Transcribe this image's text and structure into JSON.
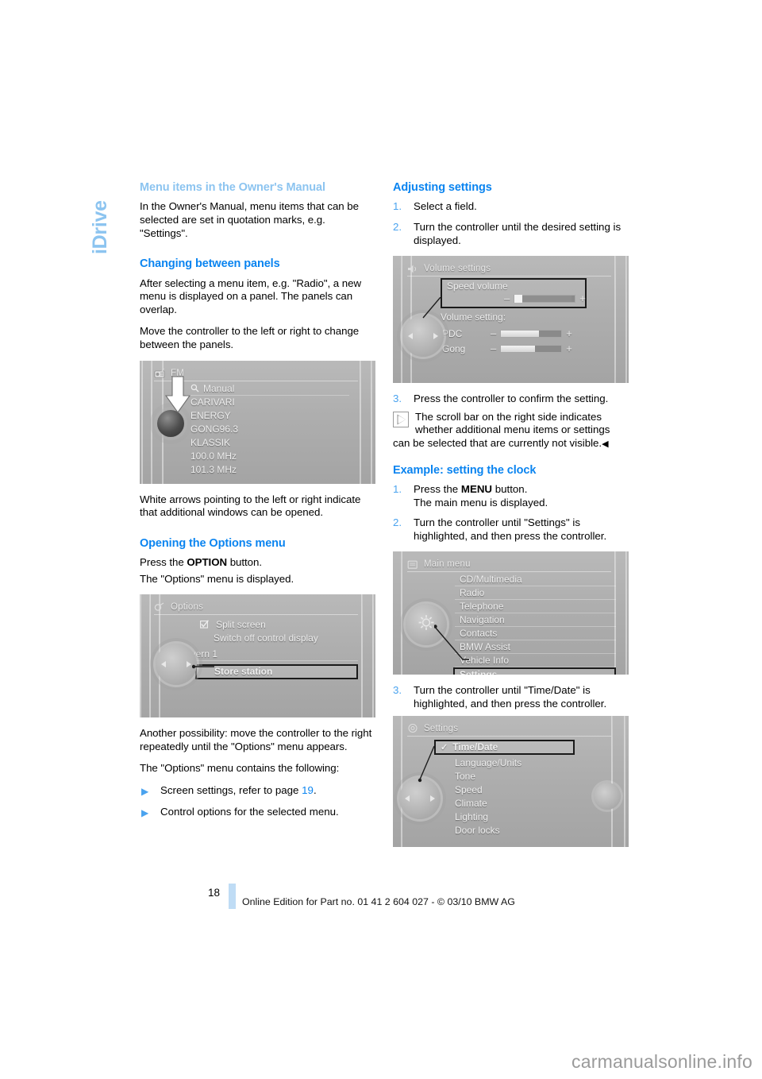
{
  "chapter_tab": "iDrive",
  "left_column": {
    "section1": {
      "heading": "Menu items in the Owner's Manual",
      "paragraphs": [
        "In the Owner's Manual, menu items that can be selected are set in quotation marks, e.g. \"Settings\"."
      ]
    },
    "section2": {
      "heading": "Changing between panels",
      "paragraph1": "After selecting a menu item, e.g. \"Radio\", a new menu is displayed on a panel. The panels can overlap.",
      "paragraph2": "Move the controller to the left or right to change between the panels.",
      "caption": "White arrows pointing to the left or right indicate that additional windows can be opened."
    },
    "section3": {
      "heading": "Opening the Options menu",
      "paragraph1": "Press the OPTION button.",
      "paragraph1_bold": "OPTION",
      "paragraph2": "The \"Options\" menu is displayed.",
      "paragraph3": "Another possibility: move the controller to the right repeatedly until the \"Options\" menu appears.",
      "paragraph4": "The \"Options\" menu contains the following:",
      "bullets": [
        {
          "text": "Screen settings, refer to page ",
          "pageref": "19",
          "suffix": "."
        },
        {
          "text": "Control options for the selected menu.",
          "pageref": "",
          "suffix": ""
        }
      ]
    }
  },
  "right_column": {
    "section1": {
      "heading": "Adjusting settings",
      "steps": [
        {
          "num": "1.",
          "text": "Select a field."
        },
        {
          "num": "2.",
          "text": "Turn the controller until the desired setting is displayed."
        },
        {
          "num": "3.",
          "text": "Press the controller to confirm the setting."
        }
      ],
      "note": "The scroll bar on the right side indicates whether additional menu items or settings can be selected that are currently not visible.",
      "note_endmark": "◀"
    },
    "section2": {
      "heading": "Example: setting the clock",
      "steps": [
        {
          "num": "1.",
          "text": "Press the MENU button.",
          "bold": "MENU",
          "subtext": "The main menu is displayed."
        },
        {
          "num": "2.",
          "text": "Turn the controller until \"Settings\" is highlighted, and then press the controller."
        },
        {
          "num": "3.",
          "text": "Turn the controller until \"Time/Date\" is highlighted, and then press the controller."
        }
      ]
    }
  },
  "figures": {
    "fm_radio": {
      "title": "FM",
      "header_icon": "radio-icon",
      "items": [
        {
          "label": "Manual",
          "icon": "search-icon",
          "ruled": true
        },
        {
          "label": "CARIVARI"
        },
        {
          "label": "ENERGY"
        },
        {
          "label": "GONG96.3"
        },
        {
          "label": "KLASSIK"
        },
        {
          "label": "100.0 MHz"
        },
        {
          "label": "101.3 MHz"
        }
      ],
      "annotation": "white-down-arrow-on-controller"
    },
    "options": {
      "title": "Options",
      "header_icon": "options-icon",
      "items": [
        {
          "label": "Split screen",
          "checkbox": true,
          "checked": true
        },
        {
          "label": "Switch off control display"
        },
        {
          "label": "Bayern 1",
          "ruled": true
        },
        {
          "label": "Store station",
          "selected": true
        }
      ]
    },
    "volume_settings": {
      "title": "Volume settings",
      "header_icon": "speaker-icon",
      "field_label": "Speed volume",
      "field_selected": true,
      "group_label": "Volume setting:",
      "sliders": [
        {
          "label": "Speed volume",
          "minus": "–",
          "plus": "+",
          "value": 12
        },
        {
          "label": "PDC",
          "minus": "–",
          "plus": "+",
          "value": 62
        },
        {
          "label": "Gong",
          "minus": "–",
          "plus": "+",
          "value": 55
        }
      ]
    },
    "main_menu": {
      "title": "Main menu",
      "header_icon": "menu-icon",
      "items": [
        {
          "label": "CD/Multimedia"
        },
        {
          "label": "Radio"
        },
        {
          "label": "Telephone"
        },
        {
          "label": "Navigation"
        },
        {
          "label": "Contacts"
        },
        {
          "label": "BMW Assist"
        },
        {
          "label": "Vehicle Info"
        },
        {
          "label": "Settings",
          "selected": true
        }
      ],
      "knob_icon": "gear-icon"
    },
    "settings": {
      "title": "Settings",
      "header_icon": "gear-icon",
      "items": [
        {
          "label": "Time/Date",
          "check": "✓",
          "selected": true
        },
        {
          "label": "Language/Units"
        },
        {
          "label": "Tone"
        },
        {
          "label": "Speed"
        },
        {
          "label": "Climate"
        },
        {
          "label": "Lighting"
        },
        {
          "label": "Door locks"
        }
      ]
    }
  },
  "footer": {
    "page_number": "18",
    "edition": "Online Edition for Part no. 01 41 2 604 027 - © 03/10 BMW AG"
  },
  "watermark": "carmanualsonline.info",
  "colors": {
    "heading_blue": "#0a84f0",
    "heading_light_blue": "#8cc4f0",
    "bullet_blue": "#4aa3ef",
    "footer_bar": "#bfdcf5"
  }
}
